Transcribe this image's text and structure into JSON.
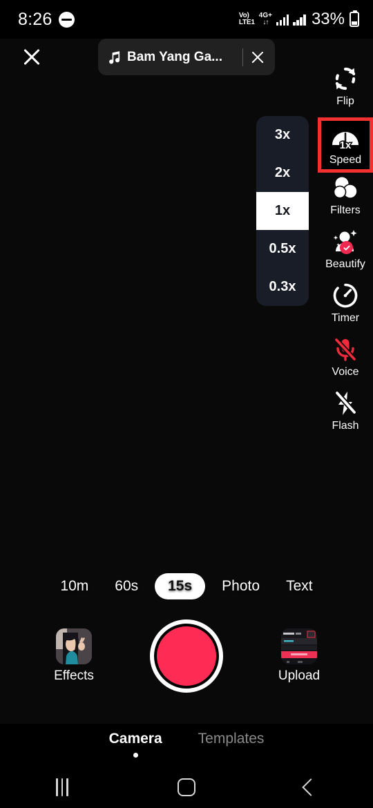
{
  "status_bar": {
    "time": "8:26",
    "dnd_icon": "do-not-disturb-icon",
    "volte_line1": "Vo)",
    "volte_line2": "LTE1",
    "network": "4G+",
    "data_arrows": "↓↑",
    "battery_percent": "33%",
    "battery_icon": "battery-icon"
  },
  "top_bar": {
    "close_icon": "close-icon",
    "music": {
      "note_icon": "music-note-icon",
      "title": "Bam Yang Ga...",
      "remove_icon": "close-icon"
    }
  },
  "tools": [
    {
      "id": "flip",
      "label": "Flip",
      "icon": "flip-camera-icon",
      "highlighted": false
    },
    {
      "id": "speed",
      "label": "Speed",
      "icon": "speedometer-icon",
      "highlighted": true,
      "badge_text": "1x"
    },
    {
      "id": "filters",
      "label": "Filters",
      "icon": "filters-icon",
      "highlighted": false
    },
    {
      "id": "beautify",
      "label": "Beautify",
      "icon": "beautify-icon",
      "highlighted": false
    },
    {
      "id": "timer",
      "label": "Timer",
      "icon": "timer-icon",
      "highlighted": false
    },
    {
      "id": "voice",
      "label": "Voice",
      "icon": "microphone-muted-icon",
      "highlighted": false
    },
    {
      "id": "flash",
      "label": "Flash",
      "icon": "flash-off-icon",
      "highlighted": false
    }
  ],
  "speed_panel": {
    "options": [
      "3x",
      "2x",
      "1x",
      "0.5x",
      "0.3x"
    ],
    "selected": "1x"
  },
  "modes": {
    "options": [
      "10m",
      "60s",
      "15s",
      "Photo",
      "Text"
    ],
    "selected": "15s"
  },
  "capture": {
    "effects_label": "Effects",
    "effects_thumb": "effects-thumbnail",
    "record_label": "record-button",
    "upload_label": "Upload",
    "upload_thumb": "upload-thumbnail"
  },
  "bottom_tabs": {
    "tabs": [
      "Camera",
      "Templates"
    ],
    "selected": "Camera"
  },
  "nav_bar": {
    "recents_icon": "recents-icon",
    "home_icon": "home-icon",
    "back_icon": "back-icon"
  },
  "colors": {
    "accent_red": "#fe2c55",
    "highlight_box": "#f23030",
    "panel_bg": "#191d28",
    "screen_bg": "#0a0909"
  }
}
